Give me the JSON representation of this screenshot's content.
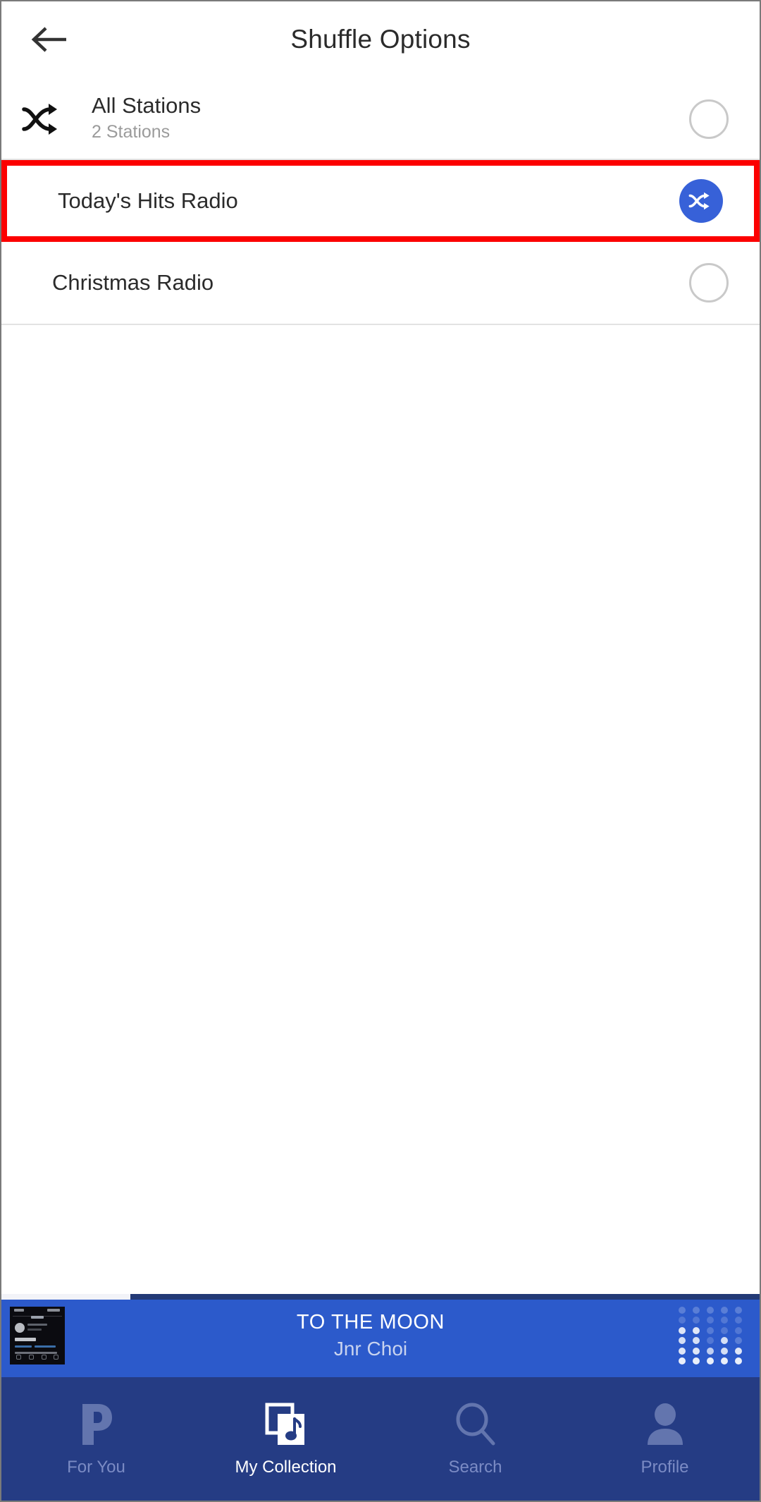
{
  "header": {
    "title": "Shuffle Options",
    "back_icon": "arrow-left-icon"
  },
  "options": [
    {
      "id": "all-stations",
      "icon": "shuffle-icon",
      "title": "All Stations",
      "subtitle": "2 Stations",
      "selected": false,
      "control_icon": "radio-unselected-icon"
    },
    {
      "id": "todays-hits-radio",
      "icon": "",
      "title": "Today's Hits Radio",
      "subtitle": "",
      "selected": true,
      "control_icon": "shuffle-icon",
      "highlighted": true
    },
    {
      "id": "christmas-radio",
      "icon": "",
      "title": "Christmas Radio",
      "subtitle": "",
      "selected": false,
      "control_icon": "radio-unselected-icon"
    }
  ],
  "player": {
    "track_title": "TO THE MOON",
    "artist": "Jnr Choi",
    "progress_percent": 17,
    "album_art_icon": "album-art-thumbnail",
    "visualizer_icon": "audio-visualizer-icon"
  },
  "nav": [
    {
      "id": "for-you",
      "label": "For You",
      "icon": "pandora-p-icon",
      "active": false
    },
    {
      "id": "my-collection",
      "label": "My Collection",
      "icon": "music-library-icon",
      "active": true
    },
    {
      "id": "search",
      "label": "Search",
      "icon": "search-icon",
      "active": false
    },
    {
      "id": "profile",
      "label": "Profile",
      "icon": "person-icon",
      "active": false
    }
  ],
  "colors": {
    "accent_blue": "#3761d8",
    "player_bg": "#2c5acb",
    "nav_bg": "#253c84",
    "highlight_red": "#fc0000",
    "nav_inactive": "#7b8bc4"
  }
}
